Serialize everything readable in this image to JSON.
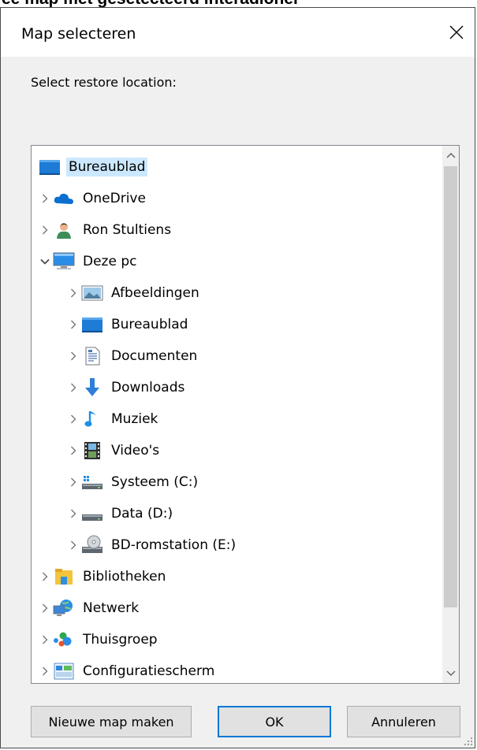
{
  "window": {
    "title": "Map selecteren",
    "background_caption": "ee map met gesetecteerd interadioner"
  },
  "prompt": "Select restore location:",
  "tree": {
    "items": [
      {
        "label": "Bureaublad",
        "icon": "desktop-icon",
        "level": 0,
        "expander": "none",
        "selected": true
      },
      {
        "label": "OneDrive",
        "icon": "onedrive-cloud-icon",
        "level": 0,
        "expander": "collapsed"
      },
      {
        "label": "Ron Stultiens",
        "icon": "user-icon",
        "level": 0,
        "expander": "collapsed"
      },
      {
        "label": "Deze pc",
        "icon": "computer-icon",
        "level": 0,
        "expander": "expanded"
      },
      {
        "label": "Afbeeldingen",
        "icon": "pictures-icon",
        "level": 1,
        "expander": "collapsed"
      },
      {
        "label": "Bureaublad",
        "icon": "desktop-icon",
        "level": 1,
        "expander": "collapsed"
      },
      {
        "label": "Documenten",
        "icon": "documents-icon",
        "level": 1,
        "expander": "collapsed"
      },
      {
        "label": "Downloads",
        "icon": "downloads-icon",
        "level": 1,
        "expander": "collapsed"
      },
      {
        "label": "Muziek",
        "icon": "music-icon",
        "level": 1,
        "expander": "collapsed"
      },
      {
        "label": "Video's",
        "icon": "videos-icon",
        "level": 1,
        "expander": "collapsed"
      },
      {
        "label": "Systeem (C:)",
        "icon": "system-drive-icon",
        "level": 1,
        "expander": "collapsed"
      },
      {
        "label": "Data (D:)",
        "icon": "drive-icon",
        "level": 1,
        "expander": "collapsed"
      },
      {
        "label": "BD-romstation (E:)",
        "icon": "bd-rom-drive-icon",
        "level": 1,
        "expander": "collapsed"
      },
      {
        "label": "Bibliotheken",
        "icon": "libraries-icon",
        "level": 0,
        "expander": "collapsed"
      },
      {
        "label": "Netwerk",
        "icon": "network-icon",
        "level": 0,
        "expander": "collapsed"
      },
      {
        "label": "Thuisgroep",
        "icon": "homegroup-icon",
        "level": 0,
        "expander": "collapsed"
      },
      {
        "label": "Configuratiescherm",
        "icon": "control-panel-icon",
        "level": 0,
        "expander": "collapsed"
      }
    ]
  },
  "buttons": {
    "new_folder": "Nieuwe map maken",
    "ok": "OK",
    "cancel": "Annuleren"
  },
  "colors": {
    "selection": "#cce8ff",
    "default_button_border": "#0078d7",
    "dialog_bg": "#f0f0f0"
  }
}
